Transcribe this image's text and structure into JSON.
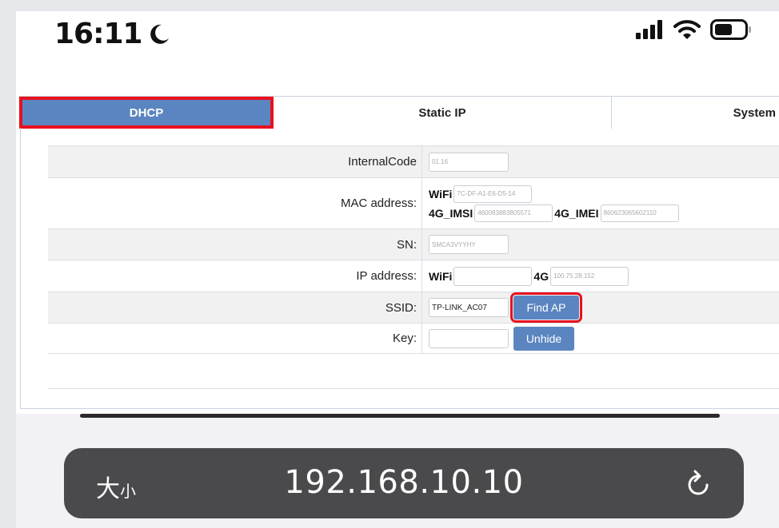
{
  "status_bar": {
    "time": "16:11"
  },
  "tabs": [
    {
      "label": "DHCP"
    },
    {
      "label": "Static IP"
    },
    {
      "label": "System"
    }
  ],
  "form": {
    "internal_code": {
      "label": "InternalCode",
      "value": "01.16"
    },
    "mac": {
      "label": "MAC address:",
      "wifi_label": "WiFi",
      "wifi_value": "7C-DF-A1-E6-D5-14",
      "imsi_label": "4G_IMSI",
      "imsi_value": "460083883805571",
      "imei_label": "4G_IMEI",
      "imei_value": "860623065602110"
    },
    "sn": {
      "label": "SN:",
      "value": "SMCA3VYYHY"
    },
    "ip": {
      "label": "IP address:",
      "wifi_label": "WiFi",
      "wifi_value": "",
      "g4_label": "4G",
      "g4_value": "100.75.28.152"
    },
    "ssid": {
      "label": "SSID:",
      "value": "TP-LINK_AC07",
      "button": "Find AP"
    },
    "key": {
      "label": "Key:",
      "value": "",
      "button": "Unhide"
    }
  },
  "browser": {
    "text_size": "大",
    "text_size_small": "小",
    "url": "192.168.10.10"
  },
  "colors": {
    "accent": "#5b85c0",
    "highlight": "#e8101e",
    "urlbar": "#4a4a4c"
  }
}
